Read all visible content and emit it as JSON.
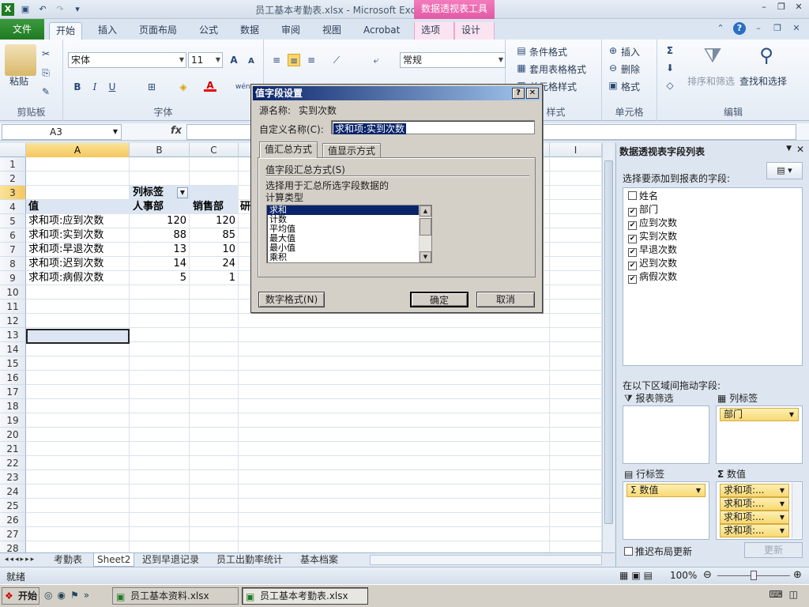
{
  "window": {
    "title": "员工基本考勤表.xlsx  -  Microsoft Excel",
    "context_tab": "数据透视表工具"
  },
  "tabs": [
    "文件",
    "开始",
    "插入",
    "页面布局",
    "公式",
    "数据",
    "审阅",
    "视图",
    "Acrobat",
    "选项",
    "设计"
  ],
  "ribbon": {
    "clipboard_label": "剪贴板",
    "paste_label": "粘贴",
    "font_label": "字体",
    "font_name": "宋体",
    "font_size": "11",
    "number_format": "常规",
    "styles_label": "样式",
    "cond_format": "条件格式",
    "table_format": "套用表格格式",
    "cell_styles": "单元格样式",
    "cells_label": "单元格",
    "insert": "插入",
    "delete": "删除",
    "format": "格式",
    "editing_label": "编辑",
    "sort_filter": "排序和筛选",
    "find_select": "查找和选择"
  },
  "formula_bar": {
    "name_box": "A3",
    "fx": "fx",
    "formula": ""
  },
  "columns": [
    "A",
    "B",
    "C",
    "I"
  ],
  "rows": [
    "1",
    "2",
    "3",
    "4",
    "5",
    "6",
    "7",
    "8",
    "9",
    "10",
    "11",
    "12",
    "13",
    "14",
    "15",
    "16",
    "17",
    "18",
    "19",
    "20",
    "21",
    "22",
    "23",
    "24",
    "25",
    "26",
    "27",
    "28"
  ],
  "pivot": {
    "col_label": "列标签",
    "header_value": "值",
    "departments": [
      "人事部",
      "销售部",
      "研"
    ],
    "rows": [
      {
        "label": "求和项:应到次数",
        "b": "120",
        "c": "120"
      },
      {
        "label": "求和项:实到次数",
        "b": "88",
        "c": "85"
      },
      {
        "label": "求和项:早退次数",
        "b": "13",
        "c": "10"
      },
      {
        "label": "求和项:迟到次数",
        "b": "14",
        "c": "24"
      },
      {
        "label": "求和项:病假次数",
        "b": "5",
        "c": "1"
      }
    ]
  },
  "sheet_tabs": [
    "考勤表",
    "Sheet2",
    "迟到早退记录",
    "员工出勤率统计",
    "基本档案"
  ],
  "status": {
    "ready": "就绪",
    "zoom": "100%"
  },
  "field_list": {
    "title": "数据透视表字段列表",
    "choose_label": "选择要添加到报表的字段:",
    "fields": [
      {
        "name": "姓名",
        "checked": false
      },
      {
        "name": "部门",
        "checked": true
      },
      {
        "name": "应到次数",
        "checked": true
      },
      {
        "name": "实到次数",
        "checked": true
      },
      {
        "name": "早退次数",
        "checked": true
      },
      {
        "name": "迟到次数",
        "checked": true
      },
      {
        "name": "病假次数",
        "checked": true
      }
    ],
    "drag_label": "在以下区域间拖动字段:",
    "report_filter": "报表筛选",
    "column_labels": "列标签",
    "row_labels": "行标签",
    "values": "数值",
    "col_item": "部门",
    "row_item": "Σ 数值",
    "value_items": [
      "求和项:...",
      "求和项:...",
      "求和项:...",
      "求和项:..."
    ],
    "defer_update": "推迟布局更新",
    "update_btn": "更新"
  },
  "dialog": {
    "title": "值字段设置",
    "source_label": "源名称:",
    "source_value": "实到次数",
    "custom_label": "自定义名称(C):",
    "custom_value": "求和项:实到次数",
    "tab1": "值汇总方式",
    "tab2": "值显示方式",
    "section": "值字段汇总方式(S)",
    "desc": "选择用于汇总所选字段数据的",
    "calc_type": "计算类型",
    "list": [
      "求和",
      "计数",
      "平均值",
      "最大值",
      "最小值",
      "乘积"
    ],
    "selected": "求和",
    "number_format_btn": "数字格式(N)",
    "ok": "确定",
    "cancel": "取消"
  },
  "taskbar": {
    "start": "开始",
    "items": [
      "员工基本资料.xlsx",
      "员工基本考勤表.xlsx"
    ]
  },
  "colors": {
    "file_tab": "#1f7a22",
    "context": "#e25aa4",
    "dialog_title": "#0a246a",
    "selection": "#f5c75c"
  }
}
